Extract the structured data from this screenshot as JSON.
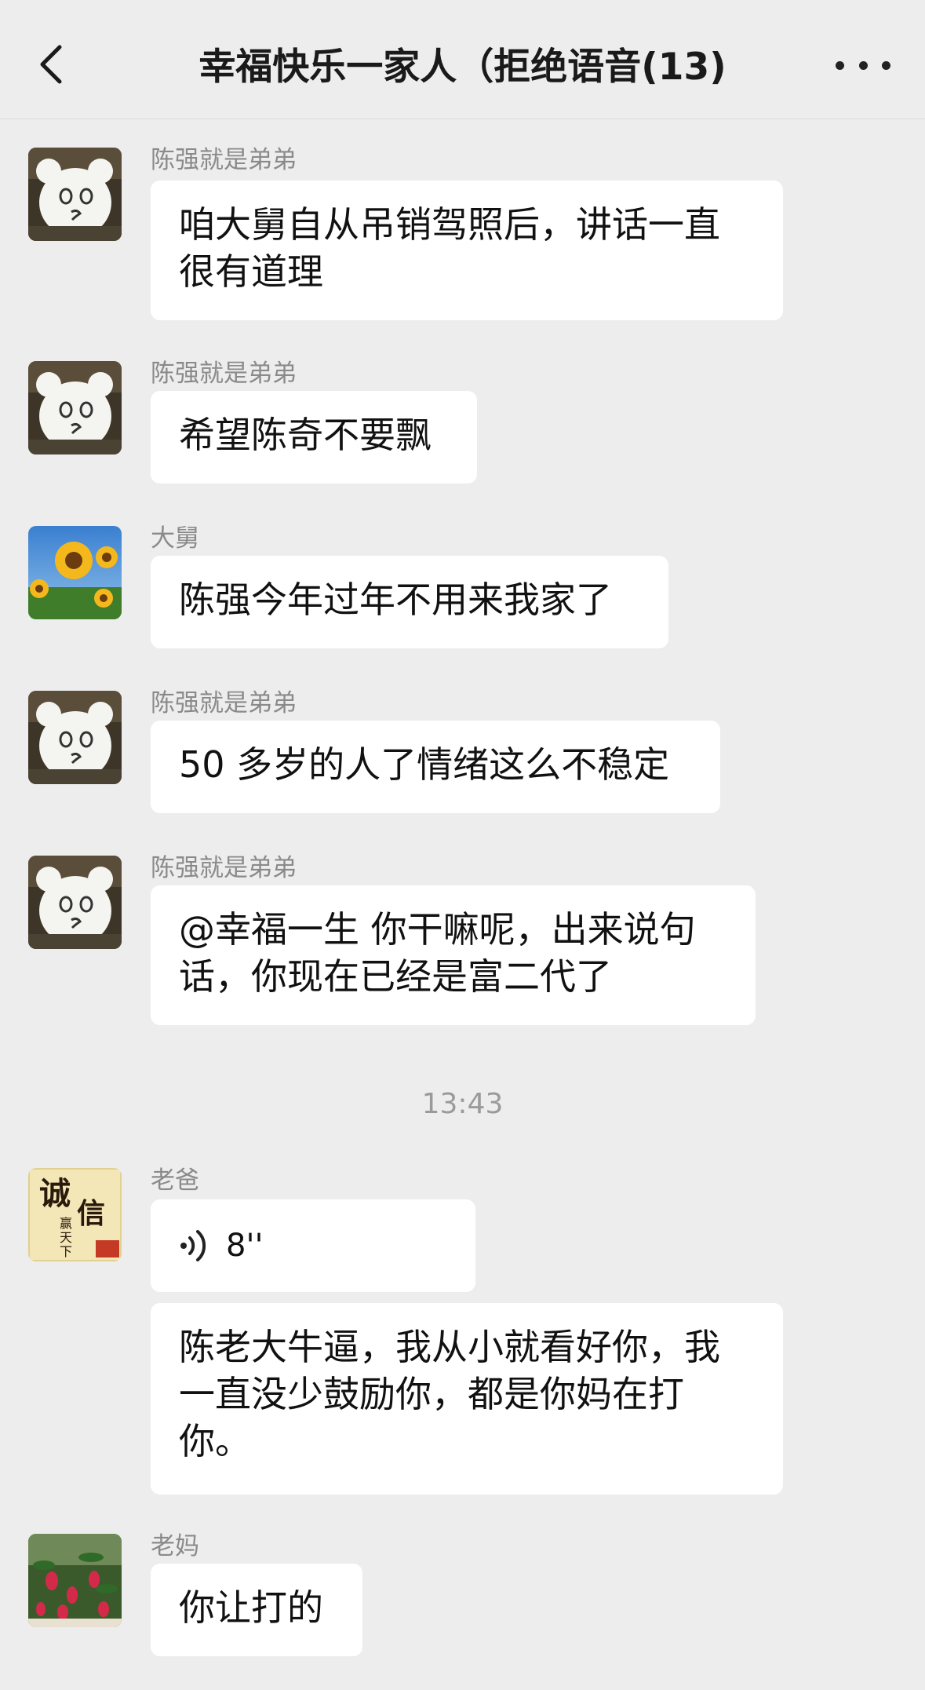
{
  "header": {
    "title": "幸福快乐一家人（拒绝语音(13)"
  },
  "timestamp": "13:43",
  "messages": [
    {
      "sender": "陈强就是弟弟",
      "text": "咱大舅自从吊销驾照后，讲话一直很有道理"
    },
    {
      "sender": "陈强就是弟弟",
      "text": "希望陈奇不要飘"
    },
    {
      "sender": "大舅",
      "text": "陈强今年过年不用来我家了"
    },
    {
      "sender": "陈强就是弟弟",
      "text": "50 多岁的人了情绪这么不稳定"
    },
    {
      "sender": "陈强就是弟弟",
      "text": "@幸福一生 你干嘛呢，出来说句话，你现在已经是富二代了"
    },
    {
      "sender": "老爸",
      "voice_length": "8''",
      "text": "陈老大牛逼，我从小就看好你，我一直没少鼓励你，都是你妈在打你。"
    },
    {
      "sender": "老妈",
      "text": "你让打的"
    }
  ],
  "avatars": {
    "dad_calligraphy": [
      "诚",
      "信",
      "赢",
      "天",
      "下"
    ]
  },
  "icons": [
    "back-arrow-icon",
    "more-dots-icon",
    "voice-wave-icon"
  ]
}
